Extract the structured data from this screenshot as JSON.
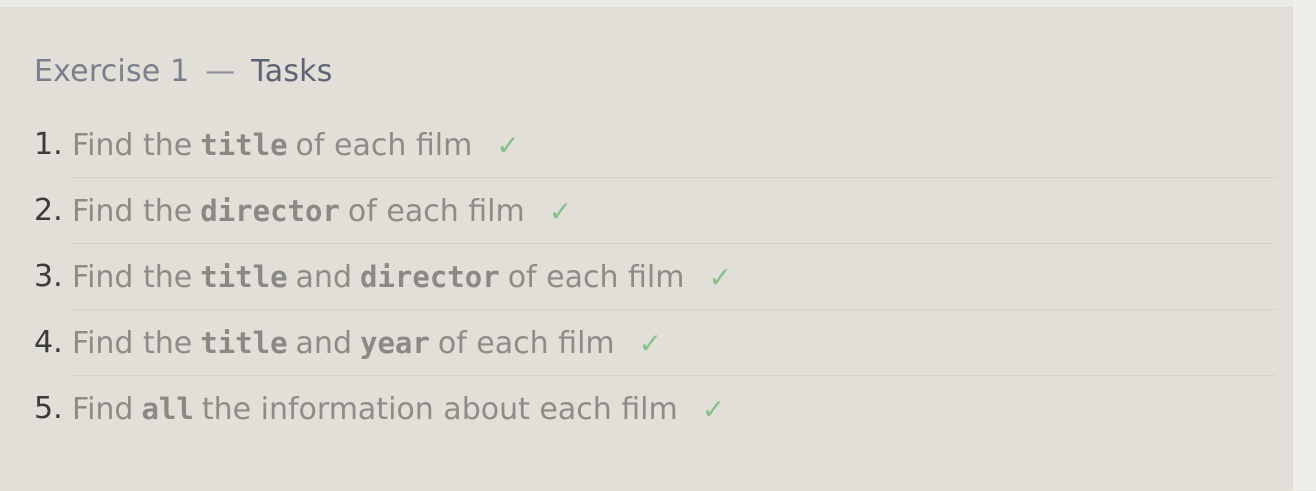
{
  "exercise": {
    "label": "Exercise 1",
    "separator": "—",
    "title": "Tasks"
  },
  "tasks": [
    {
      "number": "1.",
      "parts": [
        {
          "text": "Find the"
        },
        {
          "code": "title"
        },
        {
          "text": "of each film"
        }
      ],
      "status": "✓"
    },
    {
      "number": "2.",
      "parts": [
        {
          "text": "Find the"
        },
        {
          "code": "director"
        },
        {
          "text": "of each film"
        }
      ],
      "status": "✓"
    },
    {
      "number": "3.",
      "parts": [
        {
          "text": "Find the"
        },
        {
          "code": "title"
        },
        {
          "text": "and"
        },
        {
          "code": "director"
        },
        {
          "text": "of each film"
        }
      ],
      "status": "✓"
    },
    {
      "number": "4.",
      "parts": [
        {
          "text": "Find the"
        },
        {
          "code": "title"
        },
        {
          "text": "and"
        },
        {
          "code": "year"
        },
        {
          "text": "of each film"
        }
      ],
      "status": "✓"
    },
    {
      "number": "5.",
      "parts": [
        {
          "text": "Find"
        },
        {
          "code": "all"
        },
        {
          "text": "the information about each film"
        }
      ],
      "status": "✓"
    }
  ],
  "colors": {
    "panel_background": "#e1dfd7",
    "heading_text": "#7a7f8c",
    "task_text": "#8d8c86",
    "check_mark": "#86c08c"
  },
  "icons": {
    "status": "check-icon"
  }
}
